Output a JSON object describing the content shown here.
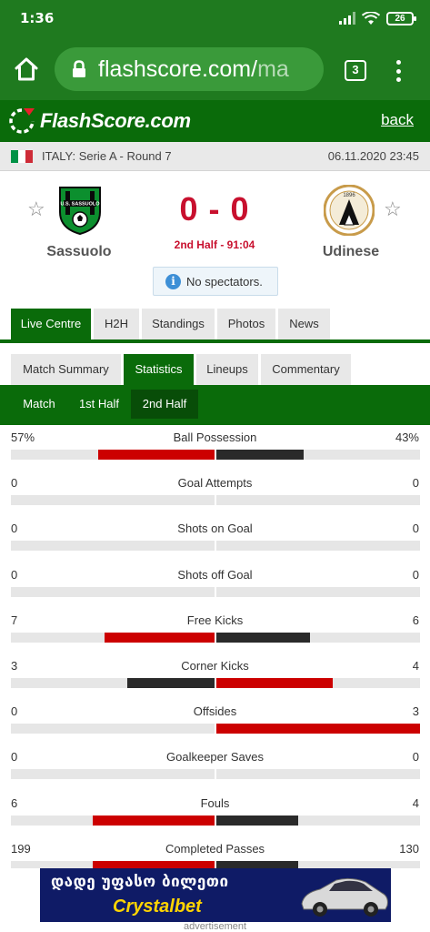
{
  "status_bar": {
    "time": "1:36",
    "battery": "26"
  },
  "browser": {
    "url_main": "flashscore.com/",
    "url_tail": "ma",
    "tab_count": "3"
  },
  "header": {
    "logo": "FlashScore.com",
    "back": "back"
  },
  "league": {
    "name": "ITALY: Serie A - Round 7",
    "date": "06.11.2020 23:45"
  },
  "match": {
    "home_team": "Sassuolo",
    "away_team": "Udinese",
    "score": "0 - 0",
    "status": "2nd Half - 91:04",
    "notice": "No spectators.",
    "home_logo_text": "U.S. SASSUOLO",
    "away_logo_text": "1896"
  },
  "main_tabs": [
    "Live Centre",
    "H2H",
    "Standings",
    "Photos",
    "News"
  ],
  "sub_tabs": [
    "Match Summary",
    "Statistics",
    "Lineups",
    "Commentary"
  ],
  "period_tabs": [
    "Match",
    "1st Half",
    "2nd Half"
  ],
  "colors": {
    "home": "#cc0000",
    "away": "#2a2a2a",
    "green": "#0a6b0a",
    "track": "#e6e6e6"
  },
  "stats": [
    {
      "name": "Ball Possession",
      "home": "57%",
      "away": "43%",
      "home_share": 0.57,
      "away_share": 0.43,
      "home_color": "red",
      "away_color": "dark"
    },
    {
      "name": "Goal Attempts",
      "home": "0",
      "away": "0",
      "home_share": 0,
      "away_share": 0
    },
    {
      "name": "Shots on Goal",
      "home": "0",
      "away": "0",
      "home_share": 0,
      "away_share": 0
    },
    {
      "name": "Shots off Goal",
      "home": "0",
      "away": "0",
      "home_share": 0,
      "away_share": 0
    },
    {
      "name": "Free Kicks",
      "home": "7",
      "away": "6",
      "home_share": 0.54,
      "away_share": 0.46,
      "home_color": "red",
      "away_color": "dark"
    },
    {
      "name": "Corner Kicks",
      "home": "3",
      "away": "4",
      "home_share": 0.43,
      "away_share": 0.57,
      "home_color": "dark",
      "away_color": "red"
    },
    {
      "name": "Offsides",
      "home": "0",
      "away": "3",
      "home_share": 0,
      "away_share": 1,
      "home_color": "dark",
      "away_color": "red"
    },
    {
      "name": "Goalkeeper Saves",
      "home": "0",
      "away": "0",
      "home_share": 0,
      "away_share": 0
    },
    {
      "name": "Fouls",
      "home": "6",
      "away": "4",
      "home_share": 0.6,
      "away_share": 0.4,
      "home_color": "red",
      "away_color": "dark"
    },
    {
      "name": "Completed Passes",
      "home": "199",
      "away": "130",
      "home_share": 0.6,
      "away_share": 0.4,
      "home_color": "red",
      "away_color": "dark"
    }
  ],
  "ad": {
    "line1": "დადე უფასო ბილეთი",
    "brand": "Crystalbet",
    "label": "advertisement"
  }
}
